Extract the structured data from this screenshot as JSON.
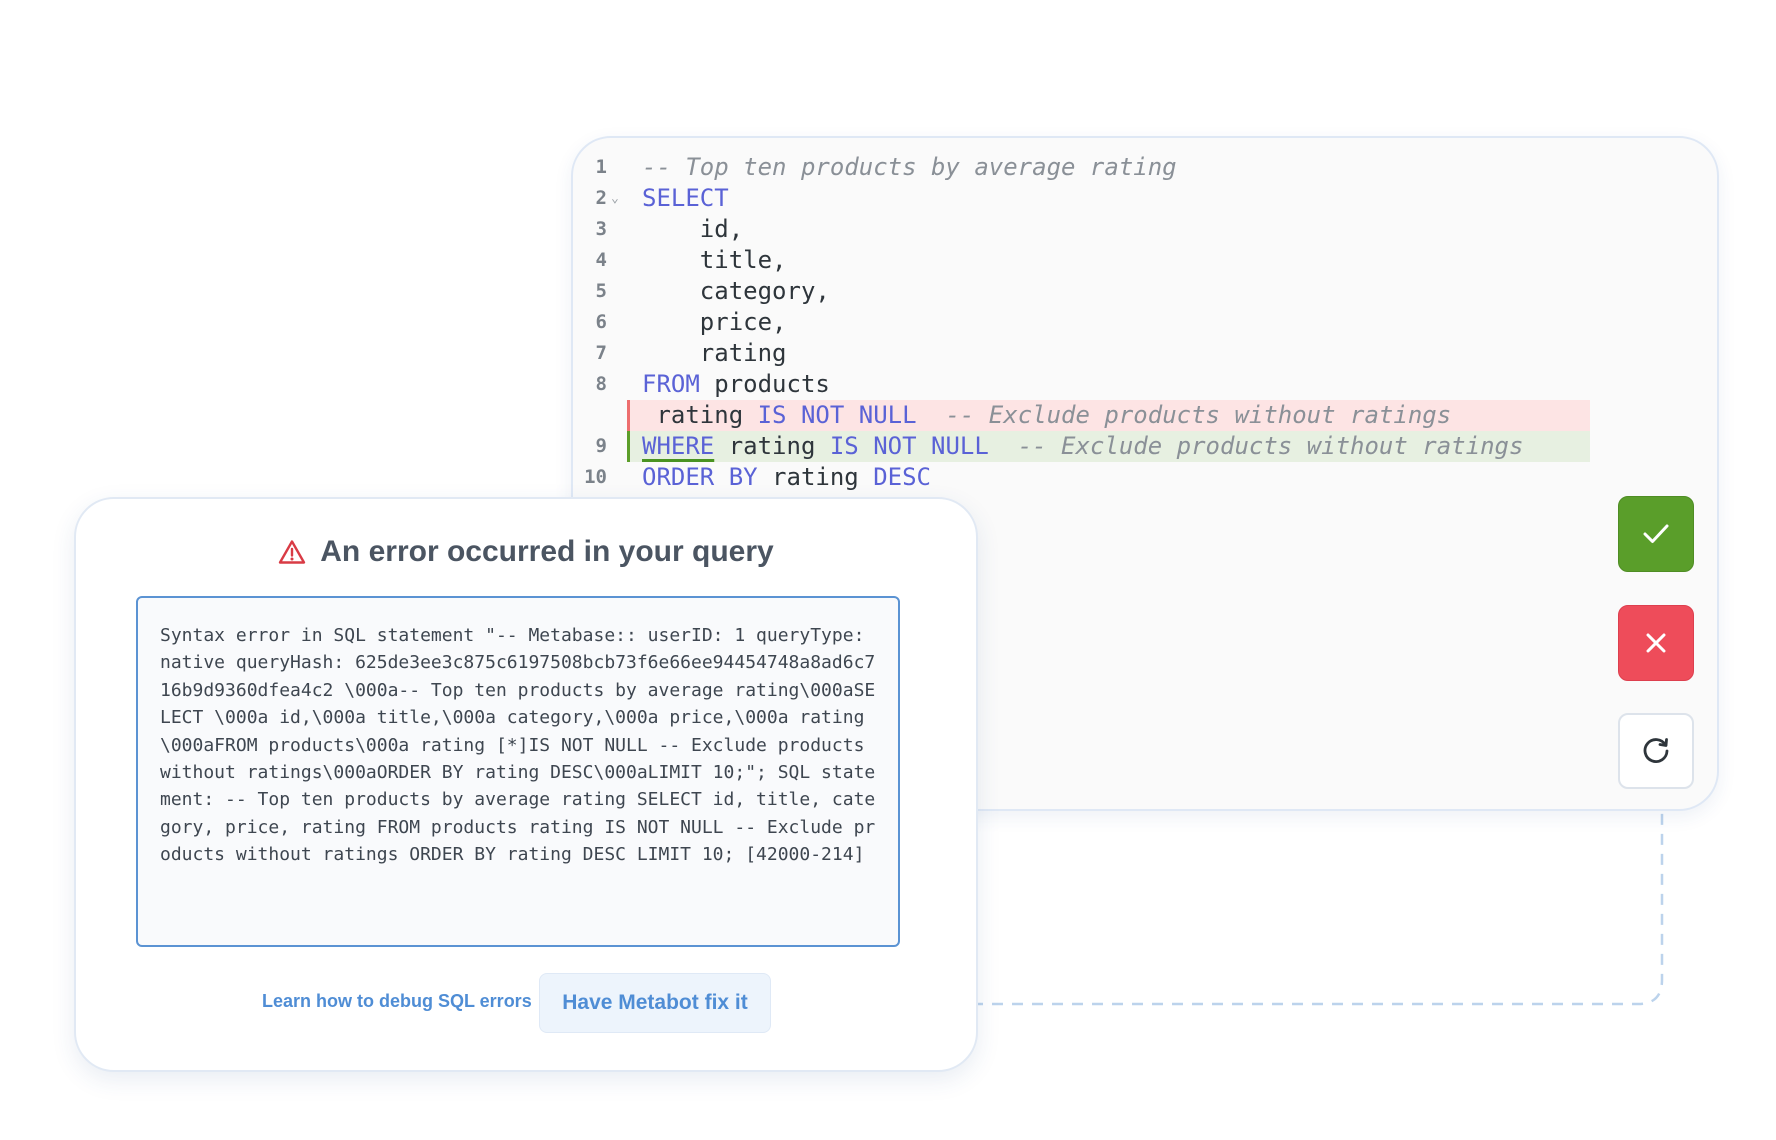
{
  "editor": {
    "lines": [
      {
        "num": "1",
        "kind": "normal",
        "fold": "",
        "tokens": [
          {
            "t": "cm",
            "v": "-- Top ten products by average rating"
          }
        ]
      },
      {
        "num": "2",
        "kind": "normal",
        "fold": "⌄",
        "tokens": [
          {
            "t": "kw",
            "v": "SELECT"
          }
        ]
      },
      {
        "num": "3",
        "kind": "normal",
        "fold": "",
        "tokens": [
          {
            "t": "tx",
            "v": "    id,"
          }
        ]
      },
      {
        "num": "4",
        "kind": "normal",
        "fold": "",
        "tokens": [
          {
            "t": "tx",
            "v": "    title,"
          }
        ]
      },
      {
        "num": "5",
        "kind": "normal",
        "fold": "",
        "tokens": [
          {
            "t": "tx",
            "v": "    category,"
          }
        ]
      },
      {
        "num": "6",
        "kind": "normal",
        "fold": "",
        "tokens": [
          {
            "t": "tx",
            "v": "    price,"
          }
        ]
      },
      {
        "num": "7",
        "kind": "normal",
        "fold": "",
        "tokens": [
          {
            "t": "tx",
            "v": "    rating"
          }
        ]
      },
      {
        "num": "8",
        "kind": "normal",
        "fold": "",
        "tokens": [
          {
            "t": "kw",
            "v": "FROM"
          },
          {
            "t": "tx",
            "v": " products"
          }
        ]
      },
      {
        "num": "",
        "kind": "removed",
        "fold": "",
        "tokens": [
          {
            "t": "tx",
            "v": " rating "
          },
          {
            "t": "kw",
            "v": "IS NOT NULL"
          },
          {
            "t": "tx",
            "v": "  "
          },
          {
            "t": "cm",
            "v": "-- Exclude products without ratings"
          }
        ]
      },
      {
        "num": "9",
        "kind": "added",
        "fold": "",
        "tokens": [
          {
            "t": "kwu",
            "v": "WHERE"
          },
          {
            "t": "tx",
            "v": " rating "
          },
          {
            "t": "kw",
            "v": "IS NOT NULL"
          },
          {
            "t": "tx",
            "v": "  "
          },
          {
            "t": "cm",
            "v": "-- Exclude products without ratings"
          }
        ]
      },
      {
        "num": "10",
        "kind": "normal",
        "fold": "",
        "tokens": [
          {
            "t": "kw",
            "v": "ORDER BY"
          },
          {
            "t": "tx",
            "v": " rating "
          },
          {
            "t": "kw",
            "v": "DESC"
          }
        ]
      }
    ]
  },
  "actions": {
    "accept_icon": "check-icon",
    "reject_icon": "close-icon",
    "retry_icon": "refresh-icon",
    "accept_color": "#5a9e2a",
    "reject_color": "#ee4c5a"
  },
  "error": {
    "title": "An error occurred in your query",
    "icon": "warning-icon",
    "message": "Syntax error in SQL statement \"-- Metabase:: userID: 1 queryType: native queryHash: 625de3ee3c875c6197508bcb73f6e66ee94454748a8ad6c716b9d9360dfea4c2 \\000a-- Top ten products by average rating\\000aSELECT \\000a id,\\000a title,\\000a category,\\000a price,\\000a rating\\000aFROM products\\000a rating [*]IS NOT NULL -- Exclude products without ratings\\000aORDER BY rating DESC\\000aLIMIT 10;\"; SQL statement: -- Top ten products by average rating SELECT id, title, category, price, rating FROM products rating IS NOT NULL -- Exclude products without ratings ORDER BY rating DESC LIMIT 10; [42000-214]",
    "learn_link": "Learn how to debug SQL errors",
    "fix_button": "Have Metabot fix it",
    "accent_color": "#4f8dd5"
  }
}
